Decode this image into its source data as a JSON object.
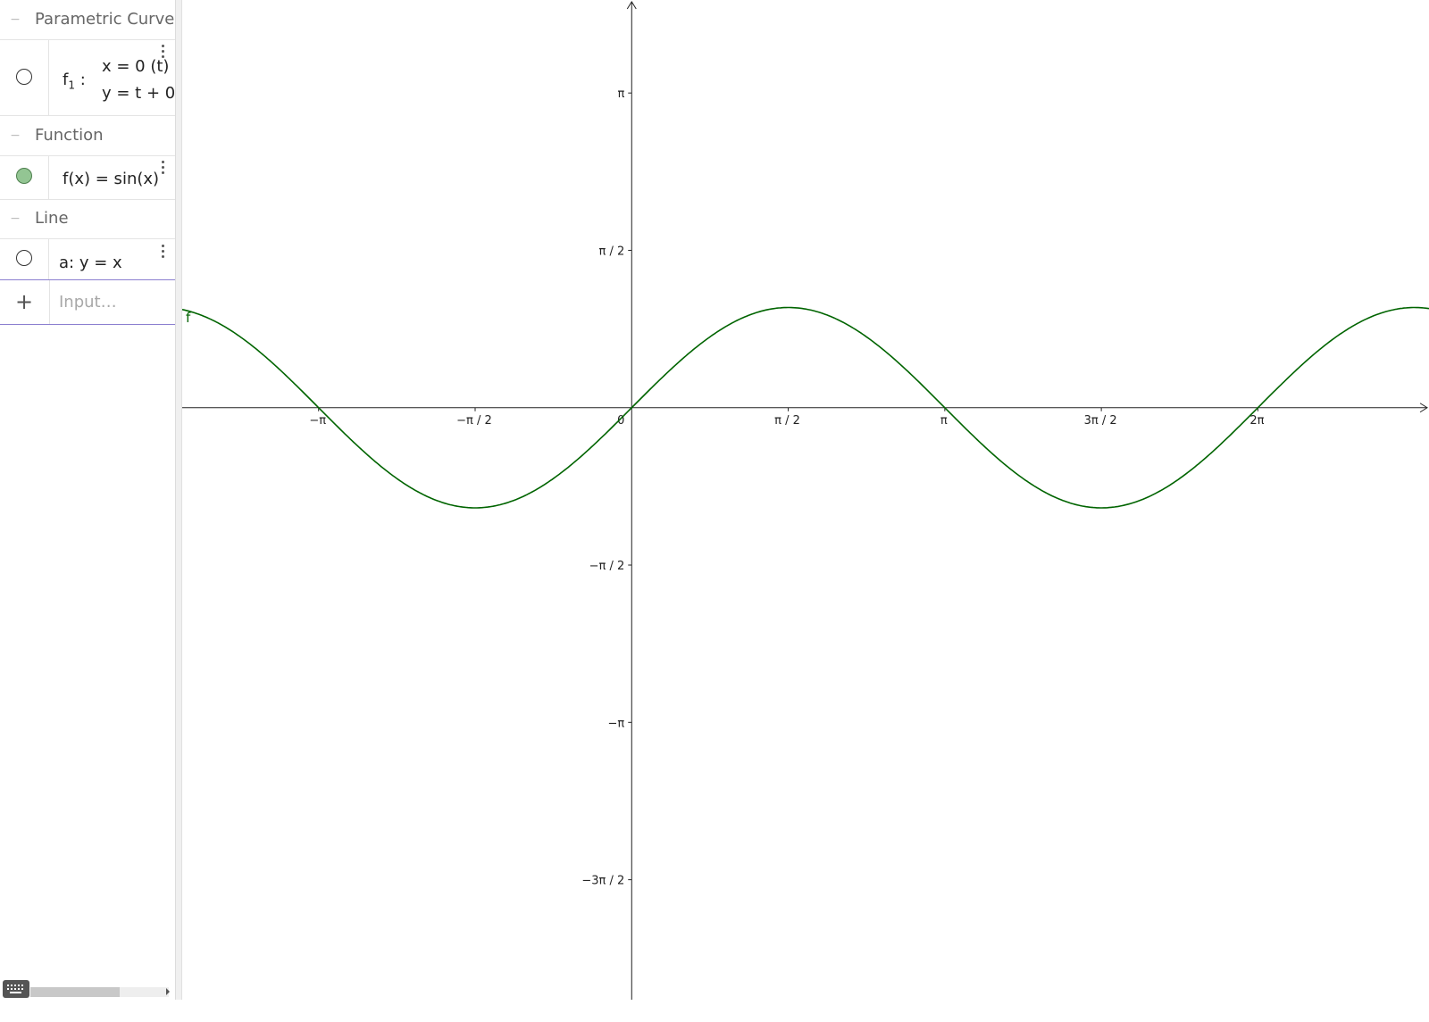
{
  "algebra": {
    "groups": [
      {
        "title": "Parametric Curve",
        "items": [
          {
            "name": "f",
            "subscript": "1",
            "colon": ":",
            "line1": "x = 0 (t)",
            "line2": "y = t + 0",
            "visible": false
          }
        ]
      },
      {
        "title": "Function",
        "items": [
          {
            "definition": "f(x)  =  sin(x)",
            "visible": true
          }
        ]
      },
      {
        "title": "Line",
        "items": [
          {
            "definition": "a: y = x",
            "visible": false
          }
        ]
      }
    ],
    "input": {
      "placeholder": "Input…",
      "plus": "+"
    }
  },
  "graphics": {
    "x_ticks": [
      "−π",
      "−π / 2",
      "0",
      "π / 2",
      "π",
      "3π / 2",
      "2π"
    ],
    "y_ticks": [
      "π",
      "π / 2",
      "−π / 2",
      "−π",
      "−3π / 2"
    ],
    "curve_label": "f",
    "colors": {
      "curve": "#006400",
      "axes": "#222222"
    }
  },
  "chart_data": {
    "type": "line",
    "title": "",
    "series": [
      {
        "name": "f",
        "function": "sin(x)"
      }
    ],
    "xlabel": "",
    "ylabel": "",
    "xlim": [
      -4.51,
      8.0
    ],
    "ylim": [
      -5.91,
      4.07
    ],
    "x_tick_values": [
      -3.14159,
      -1.5708,
      0,
      1.5708,
      3.14159,
      4.71239,
      6.28319
    ],
    "y_tick_values": [
      3.14159,
      1.5708,
      -1.5708,
      -3.14159,
      -4.71239
    ],
    "grid": false
  }
}
